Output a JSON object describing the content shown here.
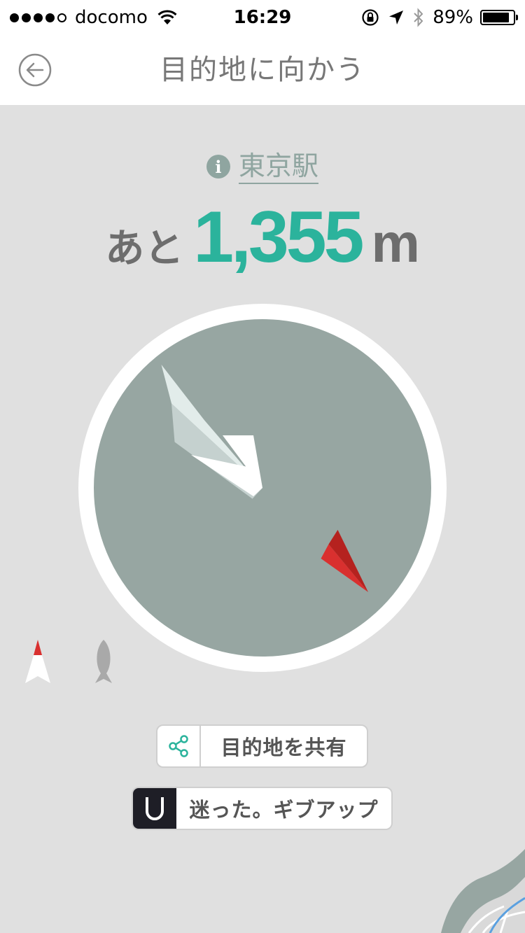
{
  "status_bar": {
    "carrier": "docomo",
    "time": "16:29",
    "battery_percent": "89%",
    "battery_level": 0.89,
    "signal_bars": 4,
    "signal_total": 5
  },
  "nav": {
    "title": "目的地に向かう",
    "back_icon": "back-arrow-circle-icon"
  },
  "destination": {
    "name": "東京駅",
    "info_icon": "info-icon"
  },
  "distance": {
    "prefix": "あと",
    "value": "1,355",
    "unit": "m"
  },
  "compass": {
    "heading_deg": 125,
    "face_color": "#97a6a2",
    "ring_color": "#ffffff",
    "needle_tip_color": "#d9302f"
  },
  "mode_icons": {
    "north_icon": "north-arrow-icon",
    "fish_icon": "fish-icon"
  },
  "actions": {
    "share_label": "目的地を共有",
    "giveup_label": "迷った。ギブアップ"
  },
  "colors": {
    "accent": "#2bb39c",
    "muted_teal": "#8fa5a0",
    "text_gray": "#6d6d6d",
    "background": "#e0e0e0"
  }
}
